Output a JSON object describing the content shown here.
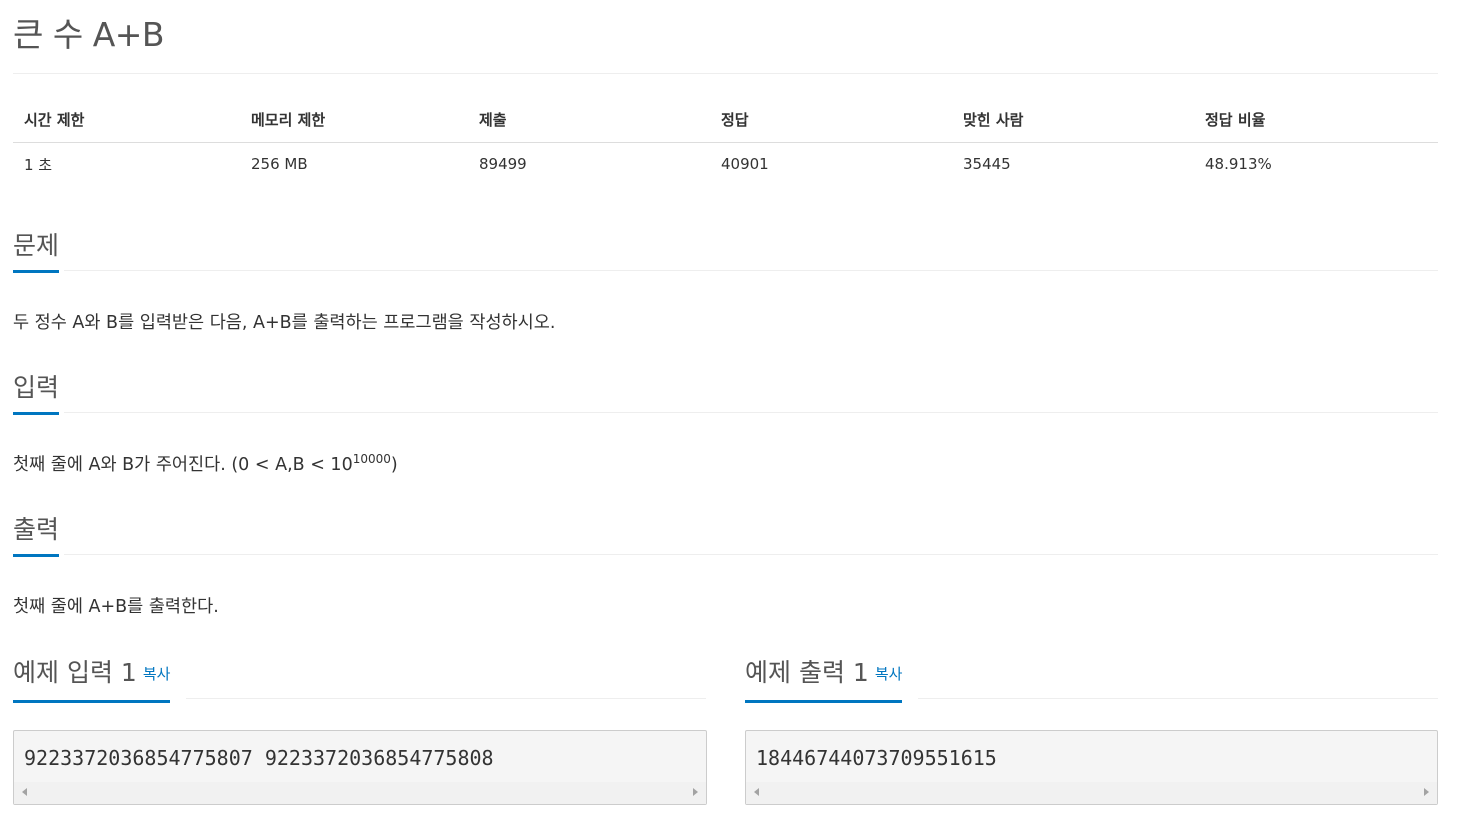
{
  "problem": {
    "title": "큰 수 A+B"
  },
  "stats": {
    "headers": [
      "시간 제한",
      "메모리 제한",
      "제출",
      "정답",
      "맞힌 사람",
      "정답 비율"
    ],
    "values": [
      "1 초",
      "256 MB",
      "89499",
      "40901",
      "35445",
      "48.913%"
    ]
  },
  "sections": {
    "problem": {
      "heading": "문제",
      "text": "두 정수 A와 B를 입력받은 다음, A+B를 출력하는 프로그램을 작성하시오."
    },
    "input": {
      "heading": "입력",
      "text_before": "첫째 줄에 A와 B가 주어진다. (0 < A,B < 10",
      "superscript": "10000",
      "text_after": ")"
    },
    "output": {
      "heading": "출력",
      "text": "첫째 줄에 A+B를 출력한다."
    }
  },
  "samples": {
    "input": {
      "heading": "예제 입력 1",
      "copy_label": "복사",
      "value": "9223372036854775807 9223372036854775808"
    },
    "output": {
      "heading": "예제 출력 1",
      "copy_label": "복사",
      "value": "18446744073709551615"
    }
  },
  "colors": {
    "accent": "#0076c0",
    "heading_text": "#555555",
    "body_text": "#333333",
    "sample_bg": "#f5f5f5"
  }
}
